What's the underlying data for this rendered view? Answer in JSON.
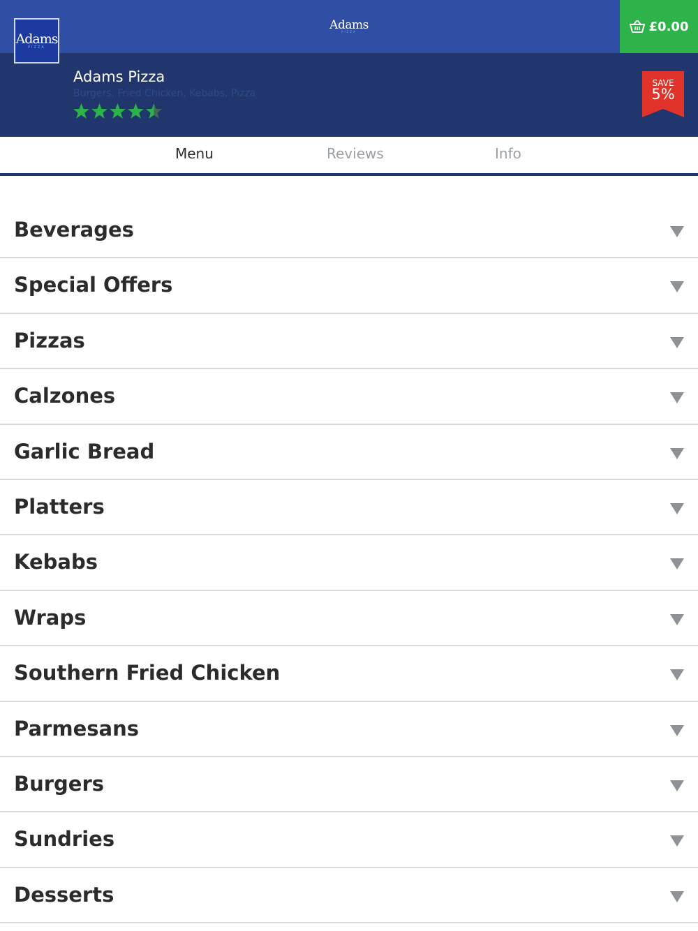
{
  "header": {
    "back_icon": "back-arrow-icon",
    "logo_text": "Adams",
    "logo_sub": "PIZZA",
    "basket_icon": "basket-icon",
    "basket_total": "£0.00",
    "basket_color": "#2db34a",
    "bar_color": "#2e4fa3"
  },
  "restaurant": {
    "logo_text": "Adams",
    "logo_sub": "PIZZA",
    "name": "Adams Pizza",
    "cuisines": "Burgers, Fried Chicken, Kebabs, Pizza",
    "rating": 4.5,
    "rating_max": 5,
    "star_color": "#2db34a",
    "save_label": "SAVE",
    "save_value": "5%",
    "save_color": "#e0342b"
  },
  "tabs": [
    {
      "label": "Menu",
      "active": true
    },
    {
      "label": "Reviews",
      "active": false
    },
    {
      "label": "Info",
      "active": false
    }
  ],
  "menu": {
    "chevron_icon": "chevron-down-icon",
    "categories": [
      "Beverages",
      "Special Offers",
      "Pizzas",
      "Calzones",
      "Garlic Bread",
      "Platters",
      "Kebabs",
      "Wraps",
      "Southern Fried Chicken",
      "Parmesans",
      "Burgers",
      "Sundries",
      "Desserts"
    ]
  }
}
